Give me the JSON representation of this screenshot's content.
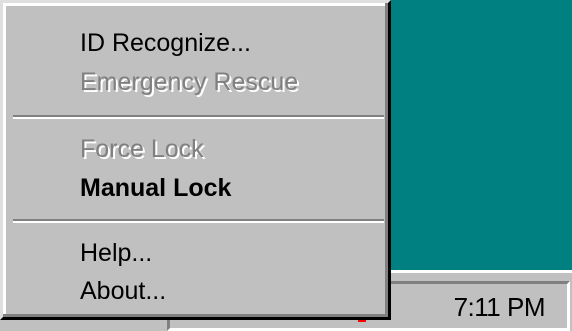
{
  "menu": {
    "items": [
      {
        "label": "ID Recognize...",
        "state": "enabled"
      },
      {
        "label": "Emergency Rescue",
        "state": "disabled"
      },
      {
        "label": "Force Lock",
        "state": "disabled"
      },
      {
        "label": "Manual Lock",
        "state": "default"
      },
      {
        "label": "Help...",
        "state": "enabled"
      },
      {
        "label": "About...",
        "state": "enabled"
      }
    ]
  },
  "taskbar": {
    "clock": "7:11 PM",
    "tray_icons": [
      "security-icon",
      "network-icon",
      "keyboard-icon",
      "folder-icon",
      "battery-icon"
    ]
  },
  "colors": {
    "desktop": "#008080",
    "face": "#c0c0c0",
    "disabled_text": "#808080"
  }
}
